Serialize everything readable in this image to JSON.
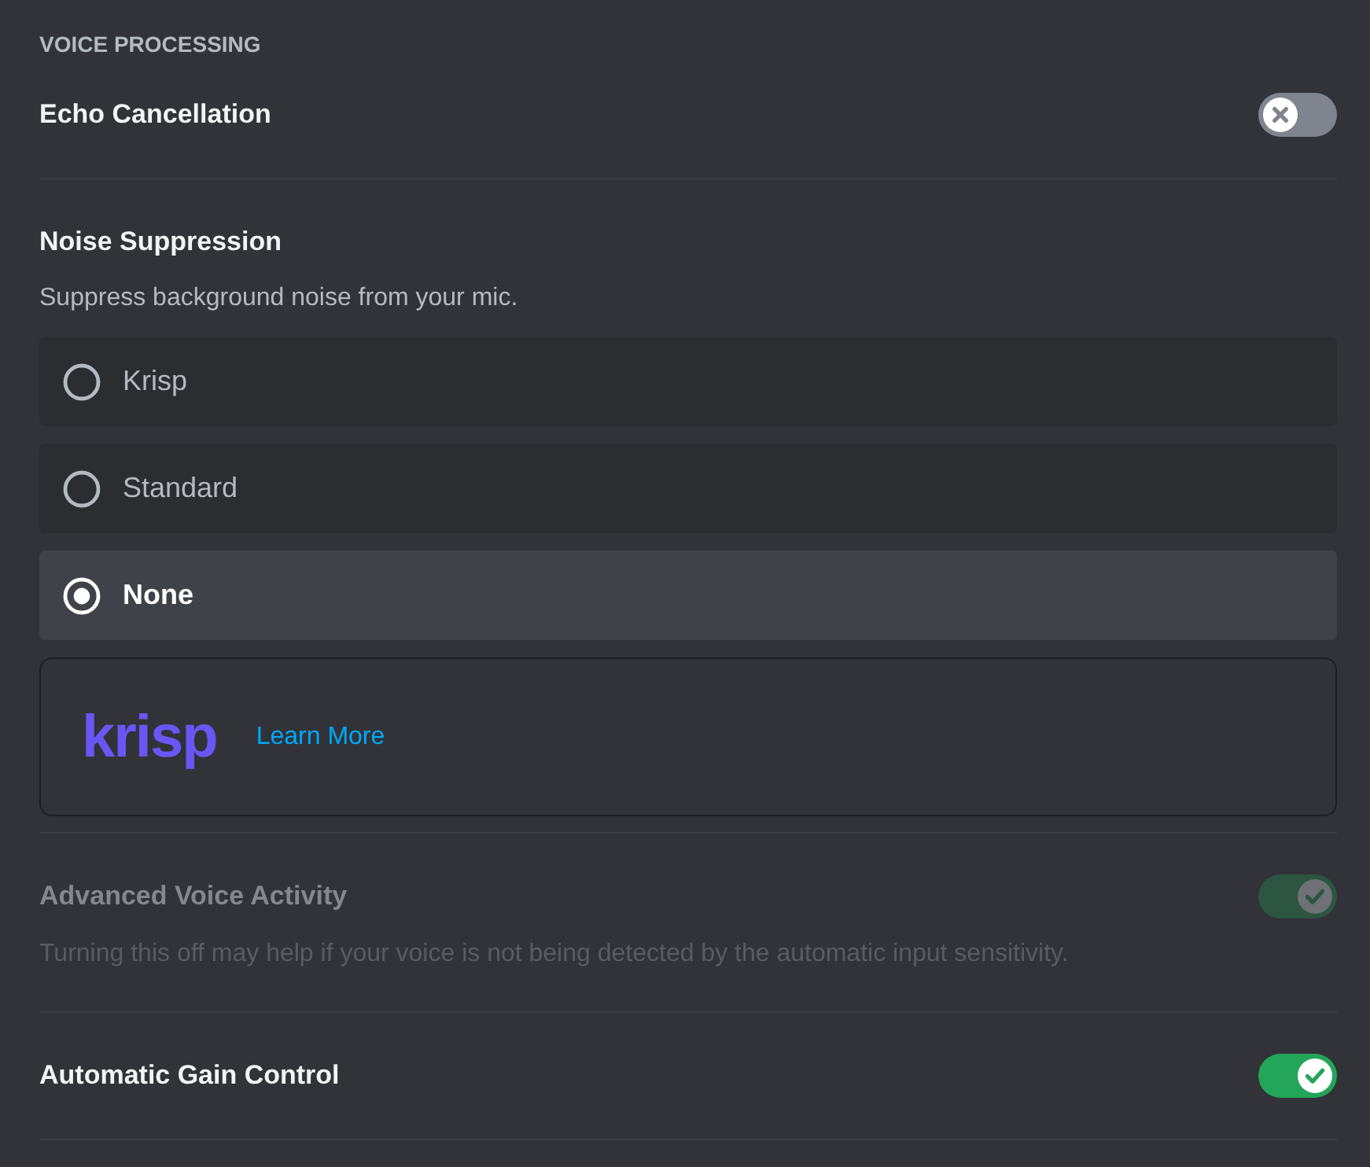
{
  "section_title": "VOICE PROCESSING",
  "settings": [
    {
      "kind": "toggle",
      "label": "Echo Cancellation",
      "on": false,
      "disabled": false
    },
    {
      "kind": "radio",
      "label": "Noise Suppression",
      "description": "Suppress background noise from your mic.",
      "options": [
        {
          "label": "Krisp",
          "selected": false
        },
        {
          "label": "Standard",
          "selected": false
        },
        {
          "label": "None",
          "selected": true
        }
      ],
      "promo": {
        "logo": "krisp",
        "link": "Learn More"
      }
    },
    {
      "kind": "toggle",
      "label": "Advanced Voice Activity",
      "description": "Turning this off may help if your voice is not being detected by the automatic input sensitivity.",
      "on": true,
      "disabled": true
    },
    {
      "kind": "toggle",
      "label": "Automatic Gain Control",
      "on": true,
      "disabled": false
    }
  ]
}
